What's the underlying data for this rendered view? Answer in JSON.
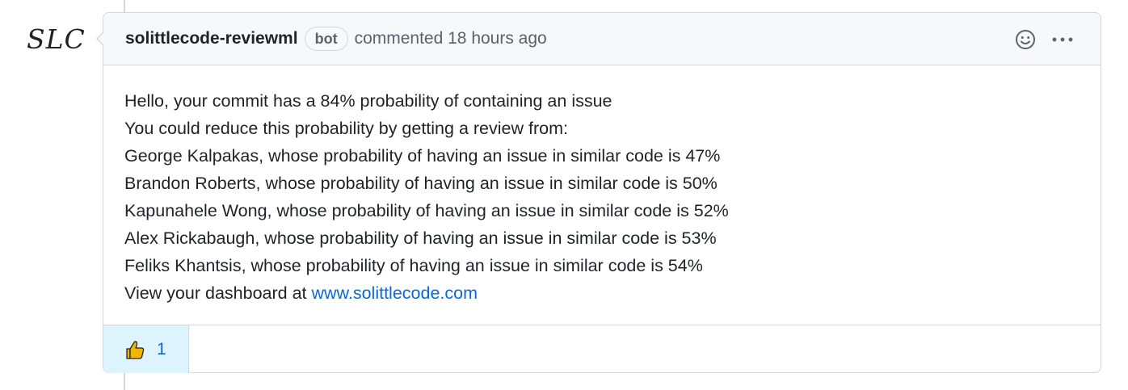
{
  "avatar": {
    "text": "SLC"
  },
  "comment": {
    "author": "solittlecode-reviewml",
    "badge": "bot",
    "action": "commented",
    "timestamp": "18 hours ago",
    "body": {
      "lines": [
        "Hello, your commit has a 84% probability of containing an issue",
        "You could reduce this probability by getting a review from:",
        "George Kalpakas, whose probability of having an issue in similar code is 47%",
        "Brandon Roberts, whose probability of having an issue in similar code is 50%",
        "Kapunahele Wong, whose probability of having an issue in similar code is 52%",
        "Alex Rickabaugh, whose probability of having an issue in similar code is 53%",
        "Feliks Khantsis, whose probability of having an issue in similar code is 54%"
      ],
      "dashboard_prefix": "View your dashboard at ",
      "dashboard_link": "www.solittlecode.com"
    }
  },
  "header_icons": [
    "smiley-icon",
    "kebab-menu-icon"
  ],
  "reactions": [
    {
      "icon": "thumbs-up-icon",
      "count": "1"
    }
  ],
  "colors": {
    "header_bg": "#f6f8fa",
    "border": "#d0d7de",
    "link": "#0969da",
    "reaction_bg": "#ddf4ff",
    "muted_text": "#59636e"
  }
}
